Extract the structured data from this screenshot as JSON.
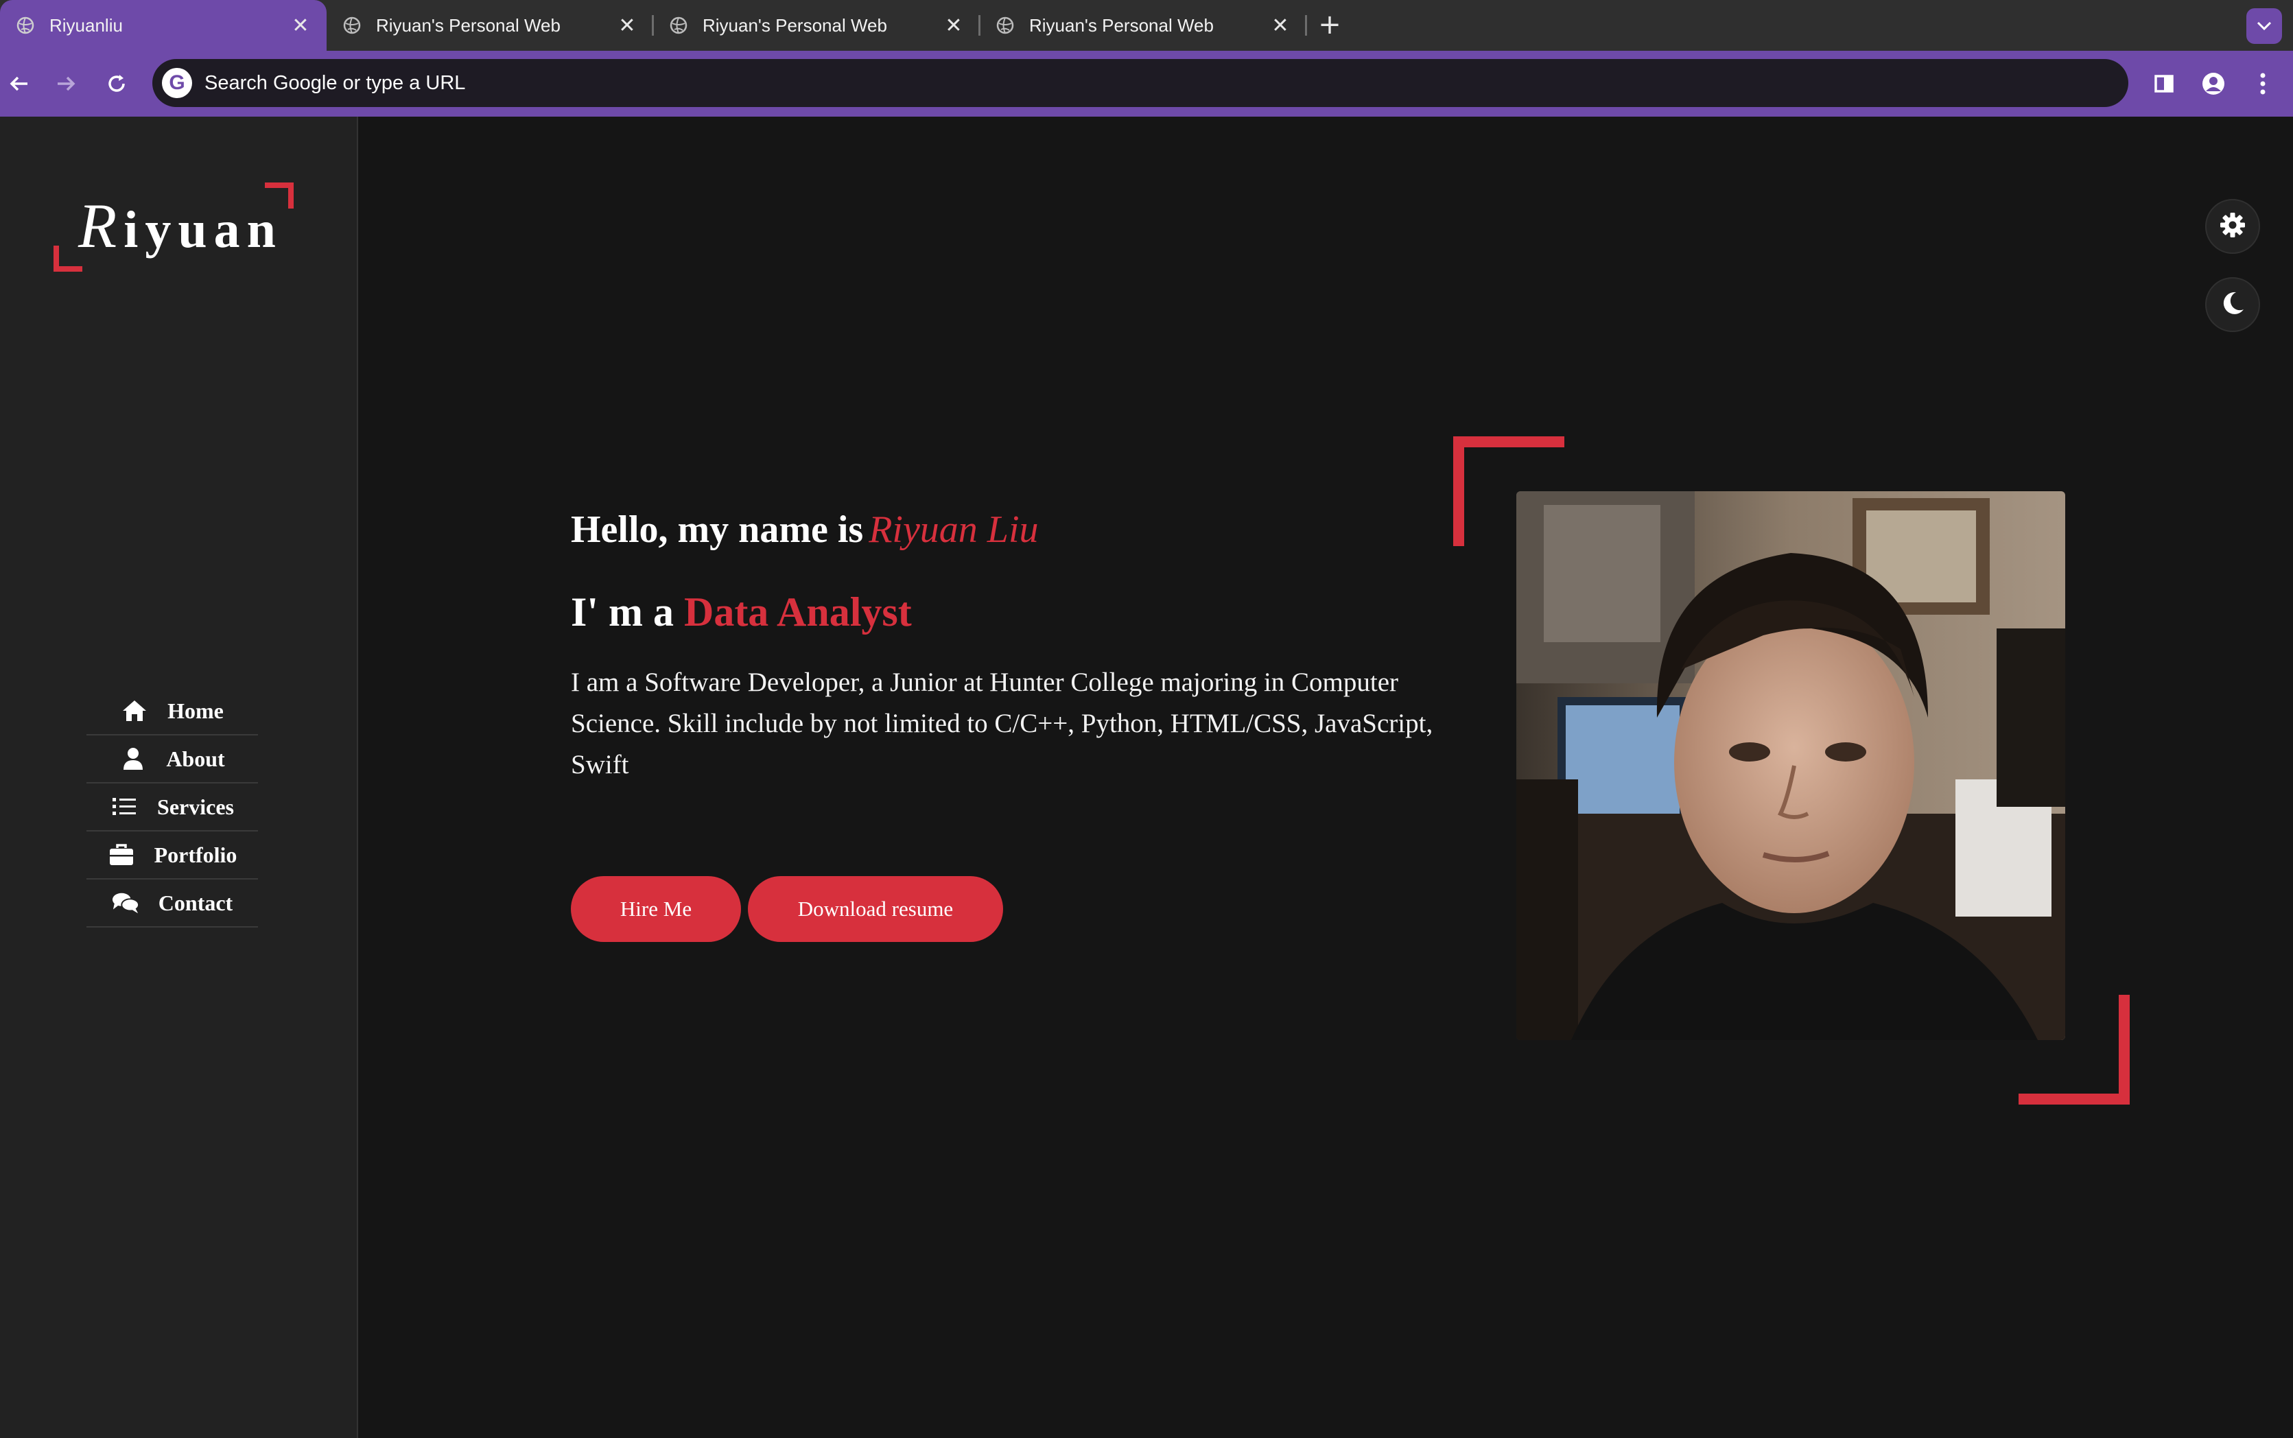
{
  "browser": {
    "tabs": [
      {
        "title": "Riyuanliu",
        "active": true
      },
      {
        "title": "Riyuan's Personal Web",
        "active": false
      },
      {
        "title": "Riyuan's Personal Web",
        "active": false
      },
      {
        "title": "Riyuan's Personal Web",
        "active": false
      }
    ],
    "omnibox_placeholder": "Search Google or type a URL",
    "accent_color": "#6e4aa9"
  },
  "sidebar": {
    "logo_cap": "R",
    "logo_rest": "iyuan",
    "nav": [
      {
        "label": "Home",
        "icon": "home-icon"
      },
      {
        "label": "About",
        "icon": "user-icon"
      },
      {
        "label": "Services",
        "icon": "list-icon"
      },
      {
        "label": "Portfolio",
        "icon": "briefcase-icon"
      },
      {
        "label": "Contact",
        "icon": "comments-icon"
      }
    ]
  },
  "hero": {
    "greeting": "Hello, my name is",
    "name": "Riyuan Liu",
    "role_prefix": "I' m a",
    "role": "Data Analyst",
    "bio": "I am a Software Developer, a Junior at Hunter College majoring in Computer Science. Skill include by not limited to C/C++, Python, HTML/CSS, JavaScript, Swift",
    "hire_button": "Hire Me",
    "resume_button": "Download resume"
  },
  "controls": {
    "settings_icon": "gear-icon",
    "theme_icon": "moon-icon"
  },
  "colors": {
    "accent_red": "#d7303d",
    "background": "#151515",
    "sidebar": "#222222"
  }
}
